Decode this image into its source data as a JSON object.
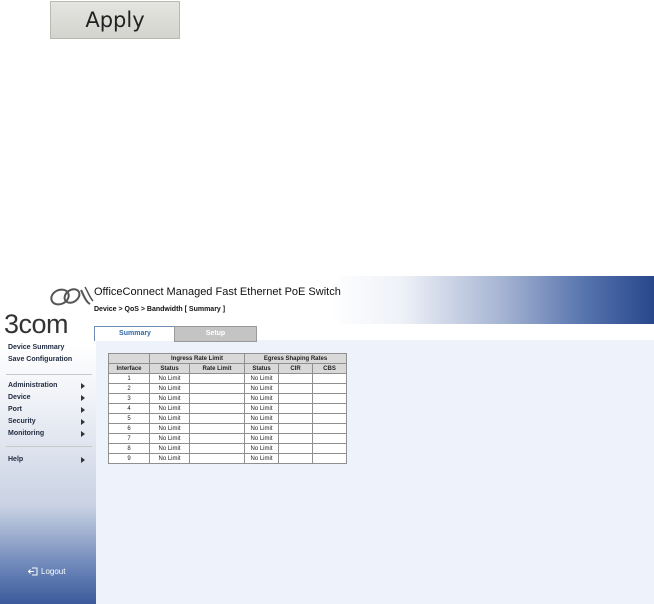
{
  "apply_button": {
    "label": "Apply"
  },
  "header": {
    "title": "OfficeConnect Managed Fast Ethernet PoE Switch",
    "breadcrumb": "Device > QoS > Bandwidth [ Summary ]"
  },
  "logo": {
    "text": "3com"
  },
  "sidebar": {
    "top_items": [
      "Device Summary",
      "Save Configuration"
    ],
    "menu_items": [
      "Administration",
      "Device",
      "Port",
      "Security",
      "Monitoring"
    ],
    "help": "Help",
    "logout": "Logout"
  },
  "tabs": [
    "Summary",
    "Setup"
  ],
  "table": {
    "group_headers": [
      "Ingress Rate Limit",
      "Egress Shaping Rates"
    ],
    "columns": [
      "Interface",
      "Status",
      "Rate Limit",
      "Status",
      "CIR",
      "CBS"
    ],
    "rows": [
      {
        "interface": "1",
        "ingress_status": "No Limit",
        "rate_limit": "",
        "egress_status": "No Limit",
        "cir": "",
        "cbs": ""
      },
      {
        "interface": "2",
        "ingress_status": "No Limit",
        "rate_limit": "",
        "egress_status": "No Limit",
        "cir": "",
        "cbs": ""
      },
      {
        "interface": "3",
        "ingress_status": "No Limit",
        "rate_limit": "",
        "egress_status": "No Limit",
        "cir": "",
        "cbs": ""
      },
      {
        "interface": "4",
        "ingress_status": "No Limit",
        "rate_limit": "",
        "egress_status": "No Limit",
        "cir": "",
        "cbs": ""
      },
      {
        "interface": "5",
        "ingress_status": "No Limit",
        "rate_limit": "",
        "egress_status": "No Limit",
        "cir": "",
        "cbs": ""
      },
      {
        "interface": "6",
        "ingress_status": "No Limit",
        "rate_limit": "",
        "egress_status": "No Limit",
        "cir": "",
        "cbs": ""
      },
      {
        "interface": "7",
        "ingress_status": "No Limit",
        "rate_limit": "",
        "egress_status": "No Limit",
        "cir": "",
        "cbs": ""
      },
      {
        "interface": "8",
        "ingress_status": "No Limit",
        "rate_limit": "",
        "egress_status": "No Limit",
        "cir": "",
        "cbs": ""
      },
      {
        "interface": "9",
        "ingress_status": "No Limit",
        "rate_limit": "",
        "egress_status": "No Limit",
        "cir": "",
        "cbs": ""
      }
    ]
  },
  "colors": {
    "tab_active_text": "#2e68a8",
    "header_gradient_end": "#27478b",
    "sidebar_bottom": "#3b5a9b"
  }
}
